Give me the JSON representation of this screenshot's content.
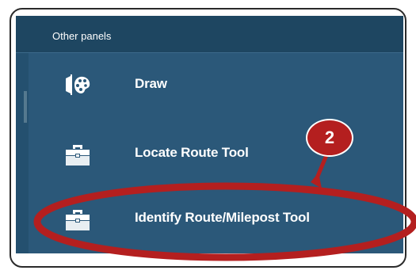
{
  "panel": {
    "header_label": "Other panels",
    "items": [
      {
        "label": "Draw",
        "icon": "draw-palette-icon"
      },
      {
        "label": "Locate Route Tool",
        "icon": "toolbox-icon"
      },
      {
        "label": "Identify Route/Milepost Tool",
        "icon": "toolbox-icon"
      }
    ]
  },
  "annotation": {
    "badge_number": "2",
    "color": "#b41f1f"
  },
  "colors": {
    "panel_bg": "#2b5879",
    "header_bg": "#1e4661",
    "text": "#ffffff"
  }
}
